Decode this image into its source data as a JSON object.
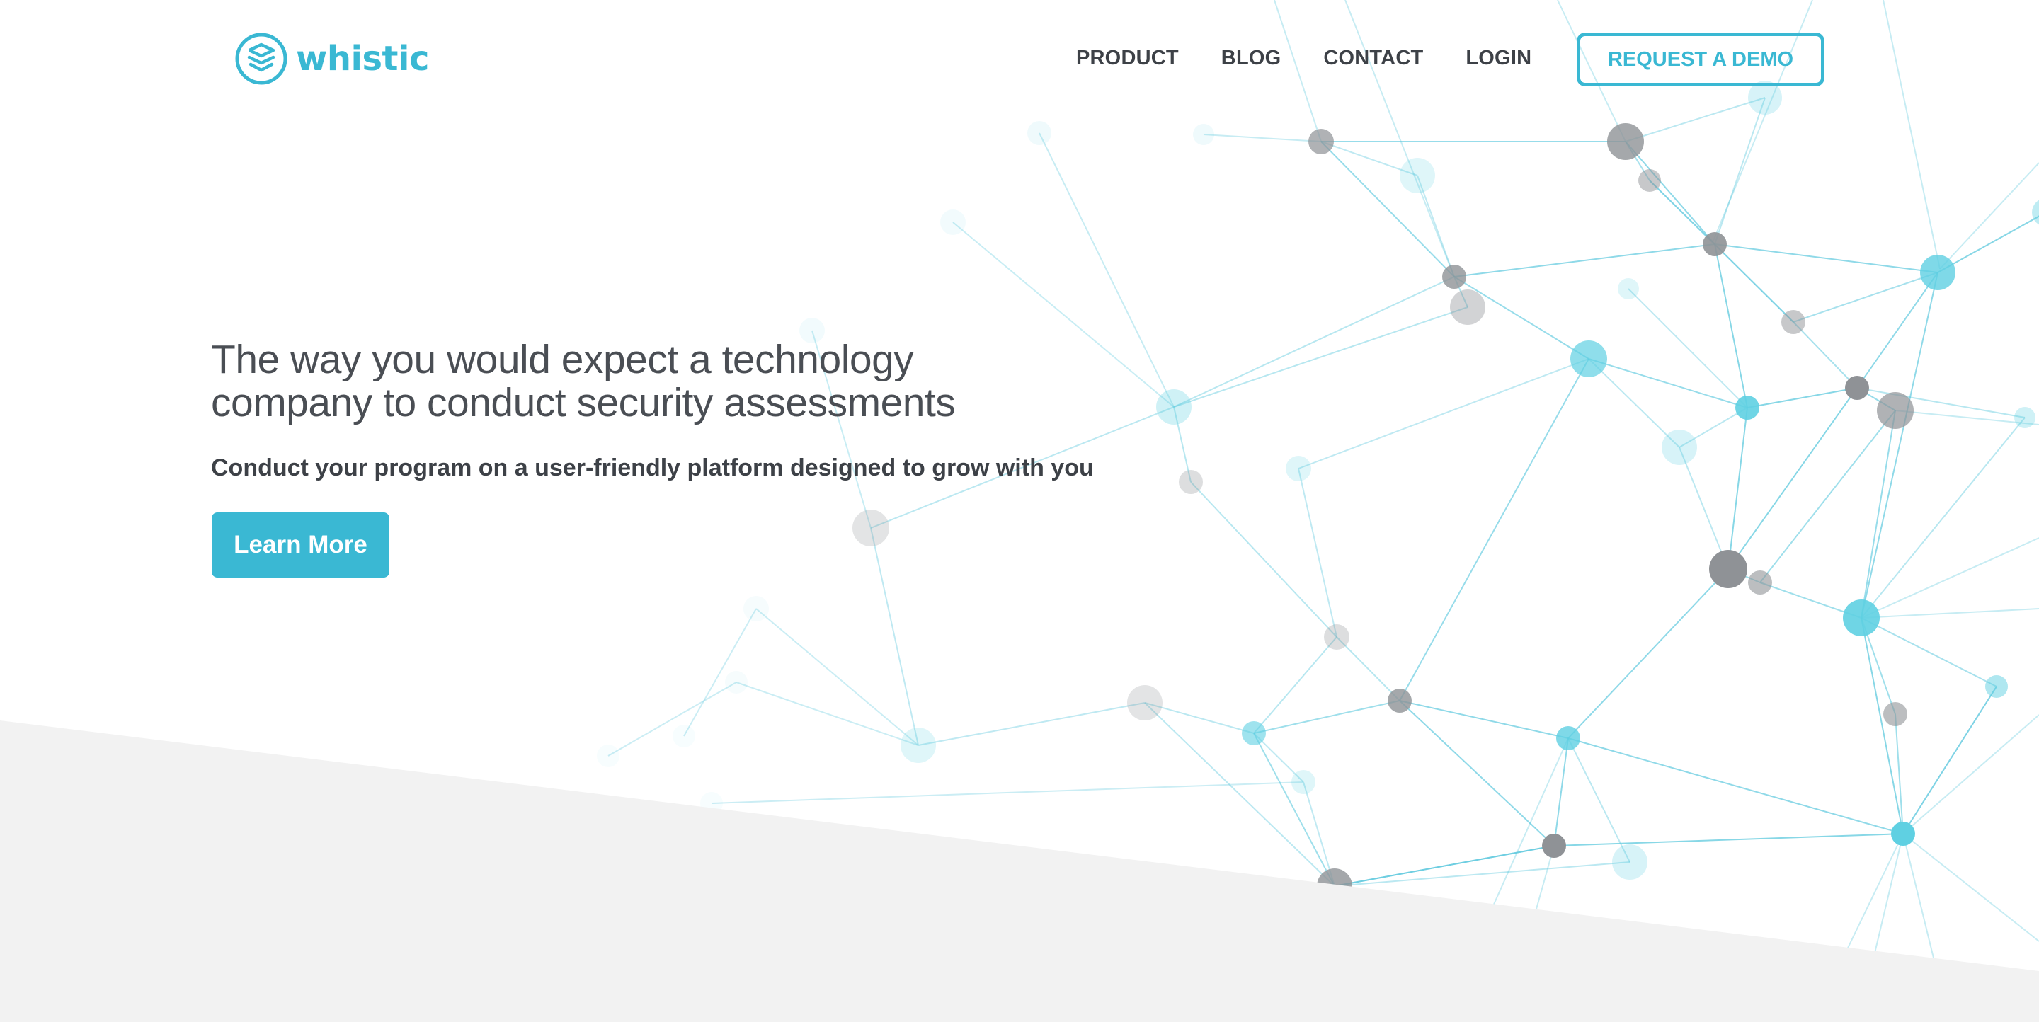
{
  "brand": {
    "name": "whistic",
    "icon": "whistic-logo-icon",
    "color": "#3ab8d3"
  },
  "nav": {
    "items": [
      {
        "label": "PRODUCT"
      },
      {
        "label": "BLOG"
      },
      {
        "label": "CONTACT"
      },
      {
        "label": "LOGIN"
      }
    ],
    "cta_label": "REQUEST A DEMO"
  },
  "hero": {
    "title_line1": "The way you would expect a technology",
    "title_line2": "company to conduct security assessments",
    "subtitle": "Conduct your program on a user-friendly platform designed to grow with you",
    "button_label": "Learn More"
  },
  "colors": {
    "accent": "#3ab8d3",
    "text_dark": "#3d4147",
    "band_gray": "#f2f2f2",
    "node_gray": "#9a9a9a",
    "node_teal": "#5fd0e2"
  }
}
